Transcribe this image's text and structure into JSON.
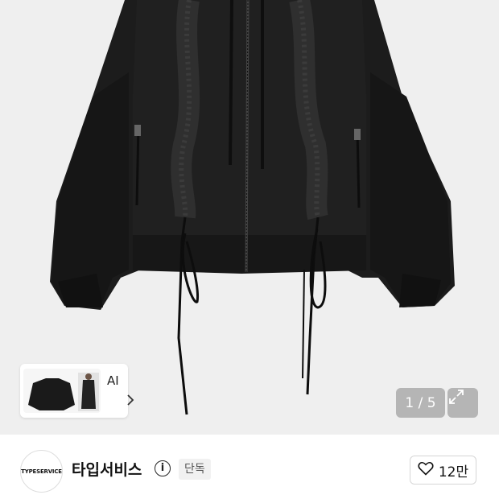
{
  "gallery": {
    "counter": "1 / 5",
    "expand_icon": "expand-arrows-icon",
    "similar": {
      "label": "AI",
      "chevron_icon": "chevron-right-icon"
    }
  },
  "brand": {
    "logo_text": "TYPESERVICE",
    "name": "타입서비스",
    "info_icon": "info-icon",
    "badge": "단독",
    "likes": {
      "icon": "heart-icon",
      "count": "12만"
    }
  }
}
